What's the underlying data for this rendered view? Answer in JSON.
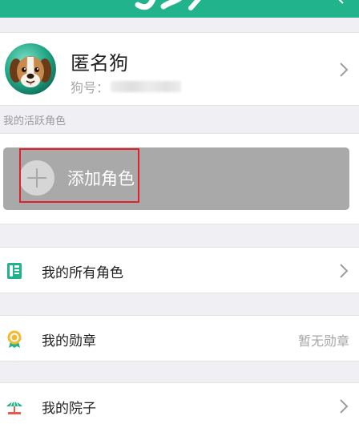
{
  "header": {
    "accent_color": "#21b38c"
  },
  "profile": {
    "name": "匿名狗",
    "id_label": "狗号："
  },
  "active_roles": {
    "section_label": "我的活跃角色",
    "add_role_label": "添加角色"
  },
  "menu": {
    "all_roles_label": "我的所有角色",
    "medals_label": "我的勋章",
    "medals_value": "暂无勋章",
    "yard_label": "我的院子"
  },
  "icons": {
    "avatar": "dog-avatar",
    "all_roles": "role-card-icon",
    "medals": "medal-icon",
    "yard": "yard-icon",
    "chevron": "chevron-right-icon"
  }
}
